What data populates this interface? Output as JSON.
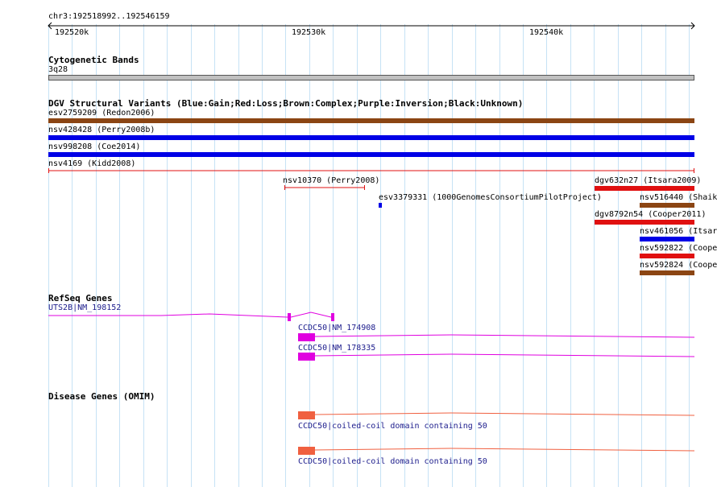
{
  "ruler": {
    "title": "chr3:192518992..192546159",
    "ticks": [
      "192520k",
      "192530k",
      "192540k"
    ]
  },
  "tracks": {
    "cytoband": {
      "title": "Cytogenetic Bands",
      "band_label": "3q28"
    },
    "dgv": {
      "title": "DGV Structural Variants (Blue:Gain;Red:Loss;Brown:Complex;Purple:Inversion;Black:Unknown)",
      "features": [
        {
          "label": "esv2759209 (Redon2006)",
          "type": "complex"
        },
        {
          "label": "nsv428428 (Perry2008b)",
          "type": "gain"
        },
        {
          "label": "nsv998208 (Coe2014)",
          "type": "gain"
        },
        {
          "label": "nsv4169 (Kidd2008)",
          "type": "loss"
        },
        {
          "label": "nsv10370 (Perry2008)",
          "type": "loss"
        },
        {
          "label": "esv3379331 (1000GenomesConsortiumPilotProject)",
          "type": "gain"
        },
        {
          "label": "dgv632n27 (Itsara2009)",
          "type": "loss"
        },
        {
          "label": "nsv516440 (Shaik",
          "type": "complex"
        },
        {
          "label": "dgv8792n54 (Cooper2011)",
          "type": "loss"
        },
        {
          "label": "nsv461056 (Itsar",
          "type": "gain"
        },
        {
          "label": "nsv592822 (Coope",
          "type": "loss"
        },
        {
          "label": "nsv592824 (Coope",
          "type": "complex"
        }
      ]
    },
    "refseq": {
      "title": "RefSeq Genes",
      "genes": [
        {
          "label": "UTS2B|NM_198152"
        },
        {
          "label": "CCDC50|NM_174908"
        },
        {
          "label": "CCDC50|NM_178335"
        }
      ]
    },
    "omim": {
      "title": "Disease Genes (OMIM)",
      "genes": [
        {
          "label": "CCDC50|coiled-coil domain containing 50"
        },
        {
          "label": "CCDC50|coiled-coil domain containing 50"
        }
      ]
    }
  },
  "colors": {
    "gridline": "#c6e2f5",
    "gain": "#0000e6",
    "loss": "#e01010",
    "complex": "#8b4513",
    "refseq": "#e000e0",
    "omim": "#f06040",
    "cytoband": "#c0c0c0"
  }
}
